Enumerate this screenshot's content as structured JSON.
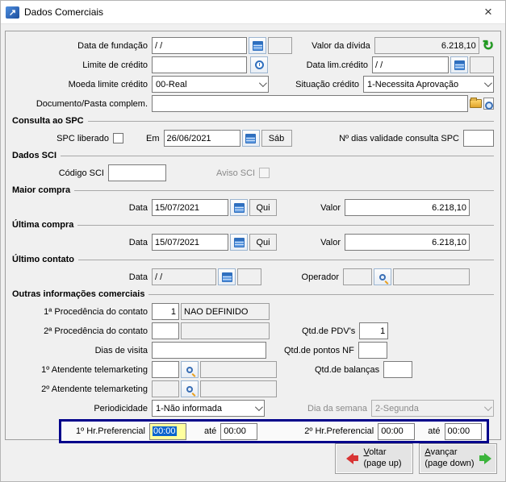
{
  "window": {
    "title": "Dados Comerciais"
  },
  "icons": {
    "title_icon": "↗",
    "close_icon": "×",
    "refresh_icon": "↻",
    "calendar_icon": "css-grid",
    "history_icon": "css-clock",
    "search_icon": "css-magnifier",
    "folder_icon": "css-folder",
    "document_search_icon": "css-doc-magnifier"
  },
  "top": {
    "data_fundacao": {
      "label": "Data de fundação",
      "value": "/ /",
      "weekday": ""
    },
    "valor_divida": {
      "label": "Valor da dívida",
      "value": "6.218,10"
    },
    "limite_credito": {
      "label": "Limite de crédito",
      "value": ""
    },
    "data_lim_credito": {
      "label": "Data lim.crédito",
      "value": "/ /",
      "weekday": ""
    },
    "moeda_limite": {
      "label": "Moeda limite crédito",
      "value": "00-Real"
    },
    "situacao_credito": {
      "label": "Situação crédito",
      "value": "1-Necessita Aprovação"
    },
    "documento": {
      "label": "Documento/Pasta complem.",
      "value": ""
    }
  },
  "spc": {
    "title": "Consulta ao SPC",
    "liberado_label": "SPC liberado",
    "em_label": "Em",
    "em_value": "26/06/2021",
    "em_weekday": "Sáb",
    "validade_label": "Nº dias validade consulta SPC",
    "validade_value": ""
  },
  "sci": {
    "title": "Dados SCI",
    "codigo_label": "Código SCI",
    "codigo_value": "",
    "aviso_label": "Aviso SCI"
  },
  "maior_compra": {
    "title": "Maior compra",
    "data_label": "Data",
    "data_value": "15/07/2021",
    "weekday": "Qui",
    "valor_label": "Valor",
    "valor_value": "6.218,10"
  },
  "ultima_compra": {
    "title": "Última compra",
    "data_label": "Data",
    "data_value": "15/07/2021",
    "weekday": "Qui",
    "valor_label": "Valor",
    "valor_value": "6.218,10"
  },
  "ultimo_contato": {
    "title": "Último contato",
    "data_label": "Data",
    "data_value": "/ /",
    "weekday": "",
    "operador_label": "Operador",
    "operador_code": "",
    "operador_name": ""
  },
  "outras": {
    "title": "Outras informações comerciais",
    "proc1": {
      "label": "1ª Procedência do contato",
      "code": "1",
      "name": "NAO DEFINIDO"
    },
    "proc2": {
      "label": "2ª Procedência do contato",
      "code": "",
      "name": ""
    },
    "qtd_pdvs": {
      "label": "Qtd.de PDV's",
      "value": "1"
    },
    "dias_visita": {
      "label": "Dias de visita",
      "value": ""
    },
    "qtd_pontos_nf": {
      "label": "Qtd.de pontos NF",
      "value": ""
    },
    "atendente1": {
      "label": "1º Atendente telemarketing",
      "code": "",
      "name": ""
    },
    "qtd_balancas": {
      "label": "Qtd.de balanças",
      "value": ""
    },
    "atendente2": {
      "label": "2º Atendente telemarketing",
      "code": "",
      "name": ""
    },
    "periodicidade": {
      "label": "Periodicidade",
      "value": "1-Não informada"
    },
    "dia_semana": {
      "label": "Dia da semana",
      "value": "2-Segunda"
    },
    "hr1": {
      "label": "1º Hr.Preferencial",
      "value": "00:00",
      "ate_label": "até",
      "ate_value": "00:00"
    },
    "hr2": {
      "label": "2º Hr.Preferencial",
      "value": "00:00",
      "ate_label": "até",
      "ate_value": "00:00"
    }
  },
  "footer": {
    "voltar_line1": "Voltar",
    "voltar_line2": "(page up)",
    "avancar_line1": "Avançar",
    "avancar_line2": "(page down)"
  },
  "colors": {
    "highlight_border": "#00008b",
    "selection": "#0a64cd",
    "focus_yellow": "#ffff9e",
    "refresh_green": "#1c9a1c",
    "back_arrow_red": "#d83434",
    "forward_arrow_green": "#3cb43c"
  }
}
